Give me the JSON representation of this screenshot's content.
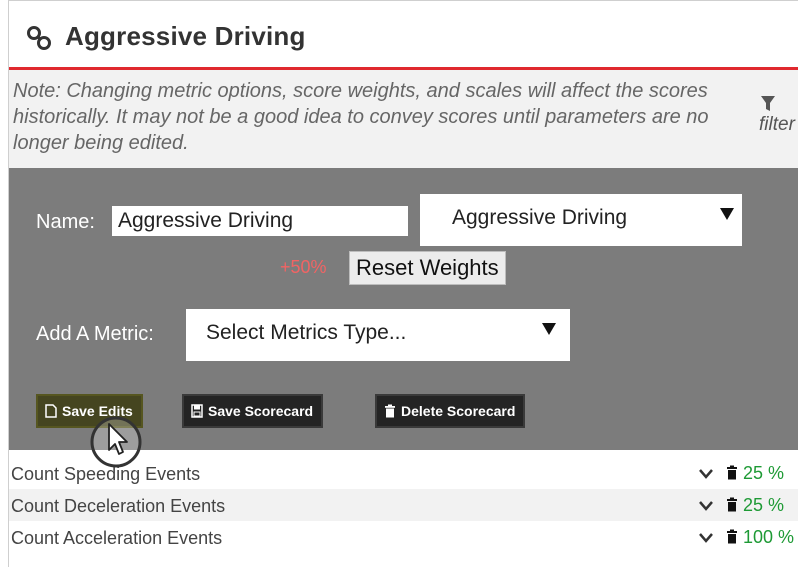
{
  "header": {
    "icon": "link-icon",
    "title": "Aggressive Driving"
  },
  "note": {
    "text": "Note: Changing metric options, score weights, and scales will affect the scores historically. It may not be a good idea to convey scores until parameters are no longer being edited.",
    "filter_label": "filter",
    "filter_icon": "funnel-icon"
  },
  "editor": {
    "name_label": "Name:",
    "name_value": "Aggressive Driving",
    "preset_select": "Aggressive Driving",
    "weight_delta": "+50%",
    "reset_weights_label": "Reset Weights",
    "add_metric_label": "Add A Metric:",
    "metric_type_select": "Select Metrics Type...",
    "buttons": {
      "save_edits": "Save Edits",
      "save_scorecard": "Save Scorecard",
      "delete_scorecard": "Delete Scorecard"
    }
  },
  "metrics": [
    {
      "name": "Count Speeding Events",
      "weight": "25 %"
    },
    {
      "name": "Count Deceleration Events",
      "weight": "25 %"
    },
    {
      "name": "Count Acceleration Events",
      "weight": "100 %"
    }
  ],
  "colors": {
    "accent_red": "#e0292f",
    "editor_bg": "#7c7c7c",
    "weight_green": "#1e9a35",
    "weight_delta": "#f16464"
  }
}
